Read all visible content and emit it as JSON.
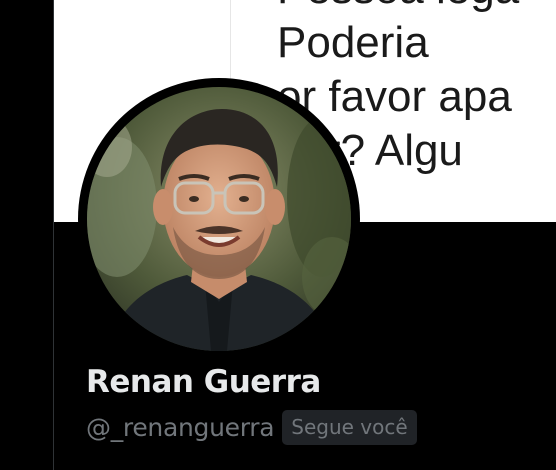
{
  "banner": {
    "lines": [
      "Pessoa lega",
      "Poderia",
      "or favor apa",
      "tter? Algu"
    ]
  },
  "profile": {
    "display_name": "Renan Guerra",
    "handle": "@_renanguerra",
    "follows_you_badge": "Segue você",
    "avatar_alt": "profile-photo"
  },
  "colors": {
    "background": "#000000",
    "name": "#e7e9ea",
    "secondary_text": "#71767b",
    "badge_bg": "#202327",
    "banner_bg": "#ffffff"
  }
}
